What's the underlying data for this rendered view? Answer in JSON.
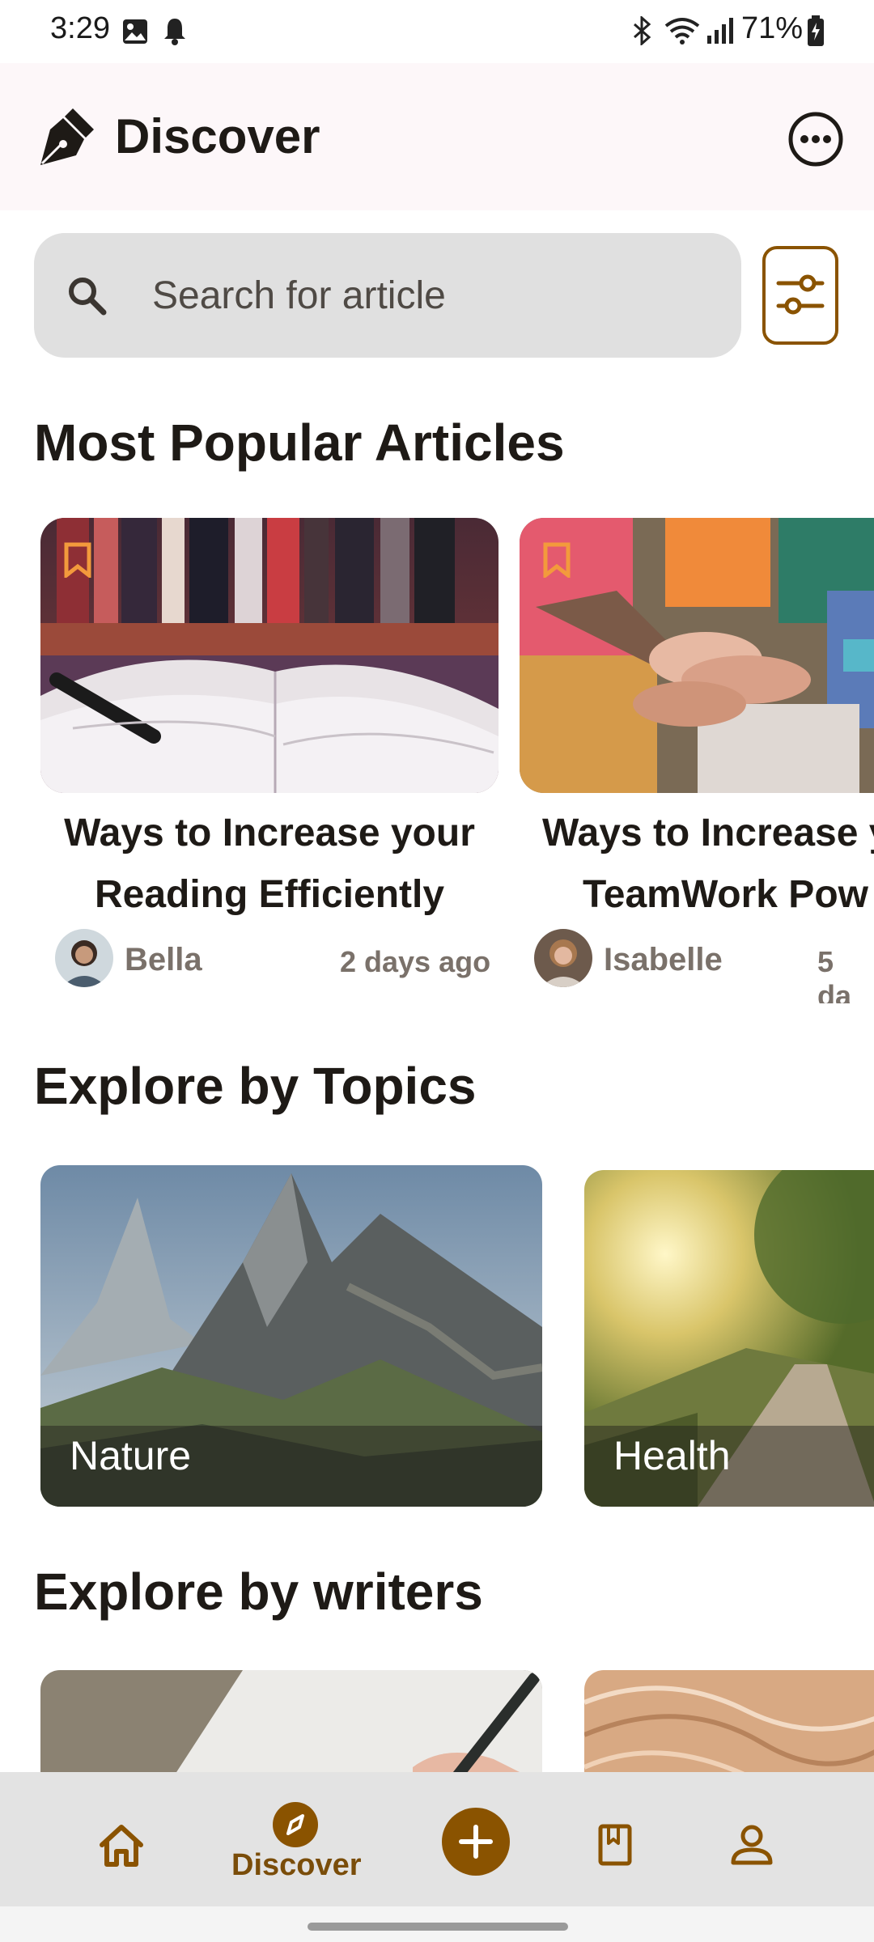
{
  "status_bar": {
    "time": "3:29",
    "battery": "71%"
  },
  "app_bar": {
    "title": "Discover"
  },
  "search": {
    "placeholder": "Search for article"
  },
  "sections": {
    "popular": "Most Popular Articles",
    "topics": "Explore by Topics",
    "writers": "Explore by writers"
  },
  "articles": [
    {
      "title_line1": "Ways to Increase your",
      "title_line2": "Reading Efficiently",
      "author": "Bella",
      "time": "2 days ago"
    },
    {
      "title_line1": "Ways to Increase y",
      "title_line2": "TeamWork Pow",
      "author": "Isabelle",
      "time": "5 da"
    }
  ],
  "topics": [
    {
      "label": "Nature"
    },
    {
      "label": "Health"
    }
  ],
  "bottom_nav": {
    "active_label": "Discover",
    "items": [
      "home-icon",
      "compass-icon",
      "add-icon",
      "bookmark-book-icon",
      "person-icon"
    ]
  },
  "colors": {
    "accent": "#8a5300",
    "bookmark": "#f39a3c",
    "nav_bg": "#e3e3e3"
  }
}
